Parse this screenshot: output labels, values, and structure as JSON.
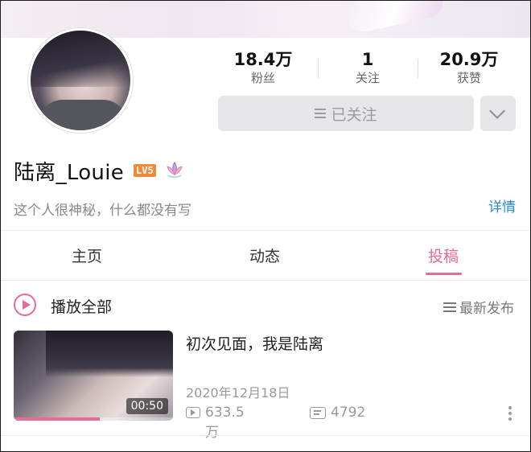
{
  "profile": {
    "name": "陆离_Louie",
    "level_badge": "LV5",
    "bio": "这个人很神秘，什么都没有写",
    "detail_link": "详情"
  },
  "stats": [
    {
      "value": "18.4万",
      "label": "粉丝"
    },
    {
      "value": "1",
      "label": "关注"
    },
    {
      "value": "20.9万",
      "label": "获赞"
    }
  ],
  "follow_button": {
    "label": "已关注"
  },
  "tabs": [
    {
      "label": "主页",
      "active": false
    },
    {
      "label": "动态",
      "active": false
    },
    {
      "label": "投稿",
      "active": true
    }
  ],
  "playlist": {
    "play_all_label": "播放全部",
    "sort_label": "最新发布"
  },
  "videos": [
    {
      "title": "初次见面，我是陆离",
      "date": "2020年12月18日",
      "duration": "00:50",
      "views": "633.5万",
      "danmaku": "4792",
      "watched_fraction": 0.54
    }
  ],
  "colors": {
    "accent_pink": "#e86a96",
    "link_blue": "#2a8bd0",
    "level_orange": "#ef8a3a"
  },
  "icons": [
    "menu-icon",
    "chevron-down-icon",
    "lotus-icon",
    "play-circle-icon",
    "sort-menu-icon",
    "views-icon",
    "danmaku-icon",
    "more-vertical-icon"
  ]
}
